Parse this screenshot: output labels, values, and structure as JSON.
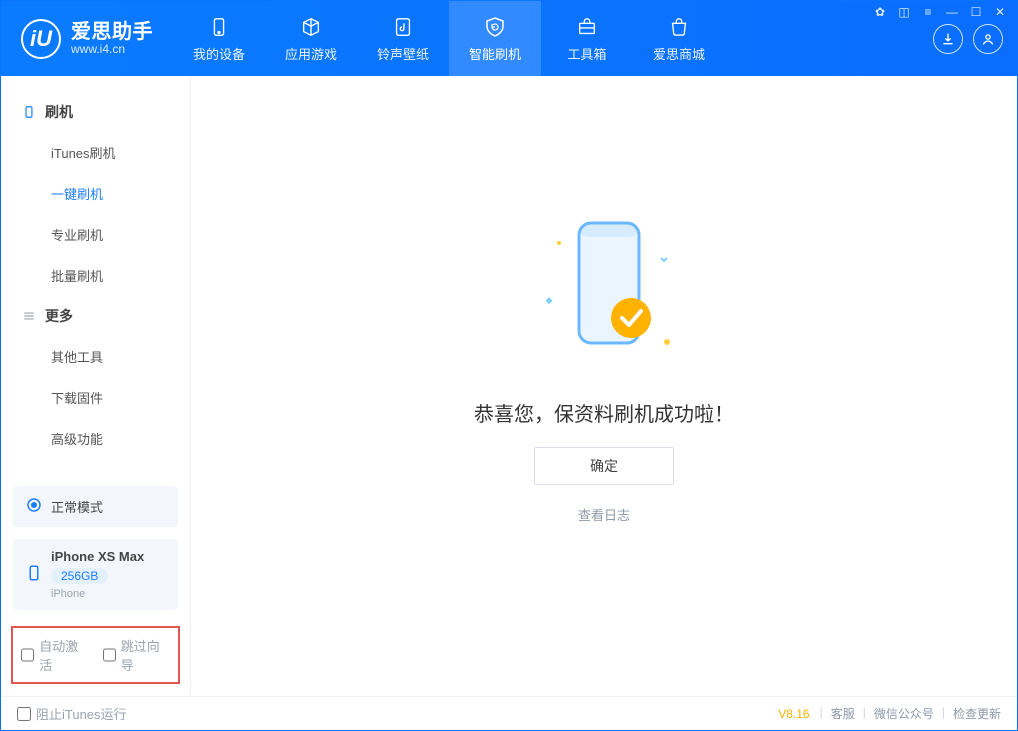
{
  "brand": {
    "name": "爱思助手",
    "url": "www.i4.cn"
  },
  "nav": {
    "tabs": [
      {
        "label": "我的设备"
      },
      {
        "label": "应用游戏"
      },
      {
        "label": "铃声壁纸"
      },
      {
        "label": "智能刷机"
      },
      {
        "label": "工具箱"
      },
      {
        "label": "爱思商城"
      }
    ],
    "active_index": 3
  },
  "sidebar": {
    "group1_title": "刷机",
    "group1_items": [
      {
        "label": "iTunes刷机"
      },
      {
        "label": "一键刷机"
      },
      {
        "label": "专业刷机"
      },
      {
        "label": "批量刷机"
      }
    ],
    "group1_active_index": 1,
    "group2_title": "更多",
    "group2_items": [
      {
        "label": "其他工具"
      },
      {
        "label": "下载固件"
      },
      {
        "label": "高级功能"
      }
    ],
    "mode_card": {
      "label": "正常模式"
    },
    "device_card": {
      "name": "iPhone XS Max",
      "storage": "256GB",
      "type": "iPhone"
    },
    "checks": {
      "auto_activate": "自动激活",
      "skip_guide": "跳过向导"
    }
  },
  "main": {
    "success_text": "恭喜您，保资料刷机成功啦！",
    "ok_label": "确定",
    "view_log": "查看日志"
  },
  "footer": {
    "block_itunes": "阻止iTunes运行",
    "version": "V8.16",
    "links": [
      {
        "label": "客服"
      },
      {
        "label": "微信公众号"
      },
      {
        "label": "检查更新"
      }
    ]
  }
}
